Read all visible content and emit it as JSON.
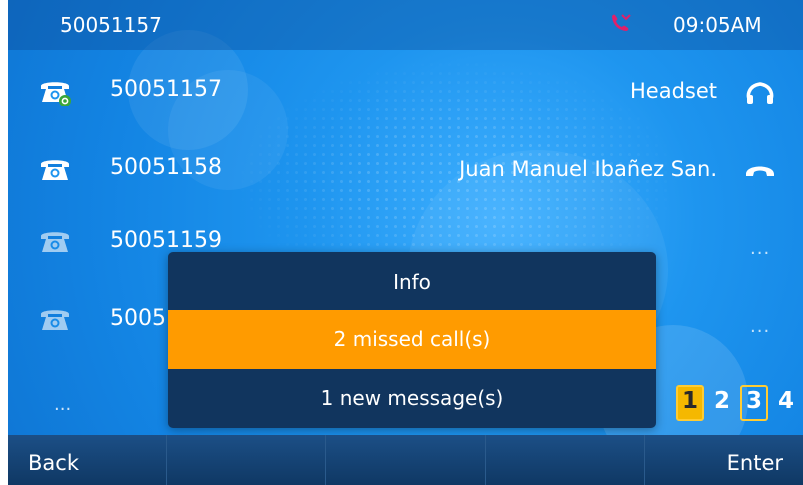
{
  "statusbar": {
    "number": "50051157",
    "time": "09:05AM",
    "icon": "missed-call-icon",
    "icon_color": "#e0206a"
  },
  "lines": [
    {
      "label": "50051157",
      "icon": "phone-registered-icon",
      "right_text": "Headset",
      "right_icon": "headset-icon"
    },
    {
      "label": "50051158",
      "icon": "phone-icon",
      "right_text": "Juan Manuel Ibañez San.",
      "right_icon": "handset-icon"
    },
    {
      "label": "50051159",
      "icon": "phone-inactive-icon",
      "right_text": "",
      "right_icon": "more-icon",
      "right_dots": "..."
    },
    {
      "label": "5005",
      "icon": "phone-inactive-icon",
      "right_text": "",
      "right_icon": "more-icon",
      "right_dots": "..."
    }
  ],
  "more_lines": "...",
  "pages": [
    "1",
    "2",
    "3",
    "4"
  ],
  "popup": {
    "title": "Info",
    "items": [
      {
        "label": "2 missed call(s)",
        "selected": true
      },
      {
        "label": "1 new message(s)",
        "selected": false
      }
    ],
    "selected_color": "#ff9b00"
  },
  "softkeys": [
    "Back",
    "",
    "",
    "",
    "Enter"
  ]
}
